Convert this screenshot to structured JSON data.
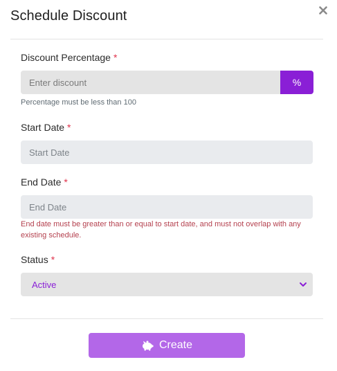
{
  "modal": {
    "title": "Schedule Discount"
  },
  "discount": {
    "label": "Discount Percentage",
    "required_mark": "*",
    "placeholder": "Enter discount",
    "suffix": "%",
    "help": "Percentage must be less than 100"
  },
  "start_date": {
    "label": "Start Date",
    "required_mark": "*",
    "placeholder": "Start Date"
  },
  "end_date": {
    "label": "End Date",
    "required_mark": "*",
    "placeholder": "End Date",
    "error": "End date must be greater than or equal to start date, and must not overlap with any existing schedule."
  },
  "status": {
    "label": "Status",
    "required_mark": "*",
    "selected": "Active"
  },
  "footer": {
    "create_label": "Create",
    "create_icon": "piggy-bank-icon"
  },
  "colors": {
    "accent": "#8a1fd6",
    "button": "#b367e8",
    "required": "#e0324b",
    "error": "#b4404e"
  }
}
